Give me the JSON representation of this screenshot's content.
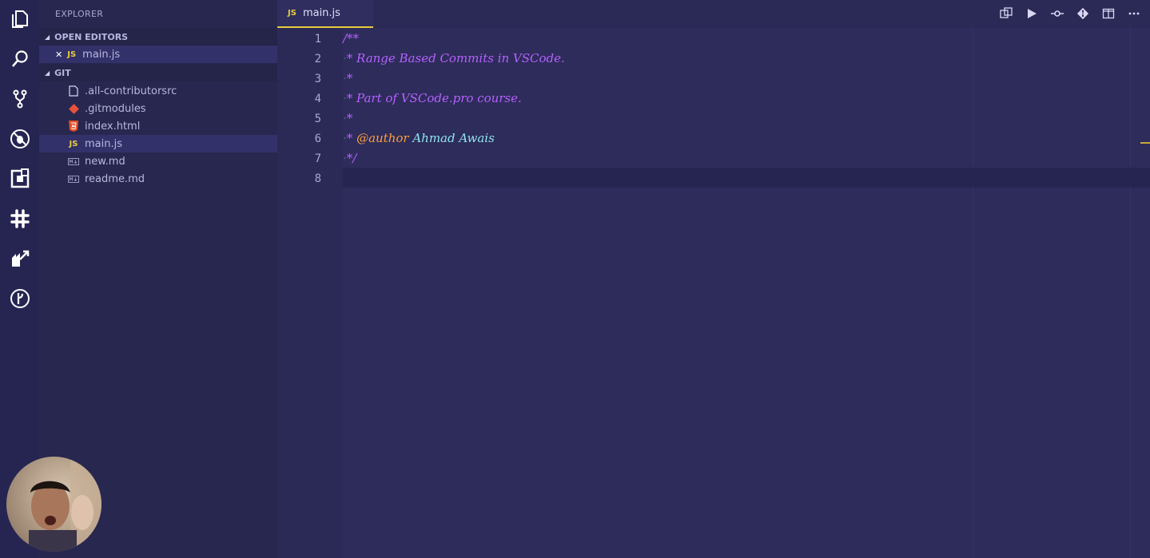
{
  "activity_bar": {
    "icons": [
      "explorer-icon",
      "search-icon",
      "source-control-icon",
      "debug-icon",
      "extensions-icon",
      "slack-icon",
      "live-share-icon",
      "git-graph-icon"
    ]
  },
  "sidebar": {
    "title": "EXPLORER",
    "open_editors": {
      "header": "OPEN EDITORS",
      "items": [
        {
          "close": "✕",
          "badge": "JS",
          "label": "main.js"
        }
      ]
    },
    "folder": {
      "header": "GIT",
      "files": [
        {
          "name": ".all-contributorsrc",
          "icon": "file-icon"
        },
        {
          "name": ".gitmodules",
          "icon": "git-icon"
        },
        {
          "name": "index.html",
          "icon": "html5-icon"
        },
        {
          "name": "main.js",
          "icon": "js-icon",
          "badge": "JS"
        },
        {
          "name": "new.md",
          "icon": "markdown-icon"
        },
        {
          "name": "readme.md",
          "icon": "markdown-icon"
        }
      ]
    }
  },
  "editor": {
    "tab": {
      "badge": "JS",
      "label": "main.js"
    },
    "toolbar": [
      "compare-icon",
      "run-icon",
      "open-changes-icon",
      "git-icon",
      "split-editor-icon",
      "more-icon"
    ],
    "line_numbers": [
      "1",
      "2",
      "3",
      "4",
      "5",
      "6",
      "7",
      "8"
    ],
    "lines": {
      "l1": "/**",
      "l2": "* Range Based Commits in VSCode.",
      "l3": "*",
      "l4": "* Part of VSCode.pro course.",
      "l5": "*",
      "l6_star": "* ",
      "l6_tag": "@author",
      "l6_name": " Ahmad Awais",
      "l7": "*/"
    }
  },
  "colors": {
    "comment": "#b461ff",
    "tag": "#ff9f3a",
    "name": "#8fe3f0",
    "tab_accent": "#e6cc3f"
  }
}
